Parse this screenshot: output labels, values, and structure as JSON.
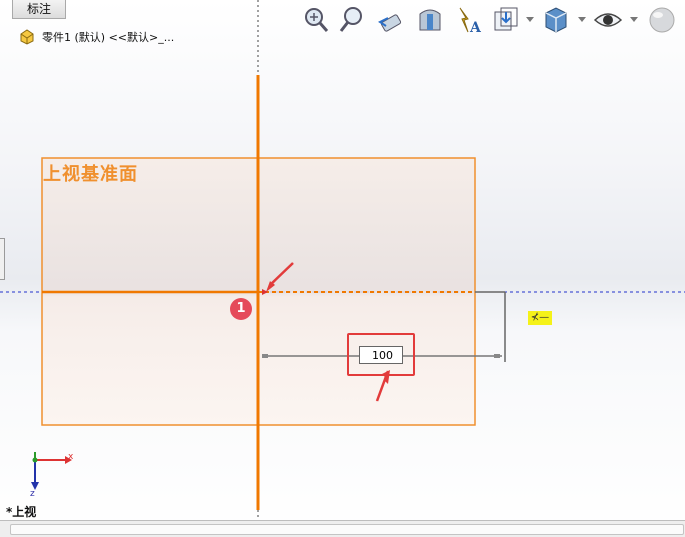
{
  "panel": {
    "tab_label": "标注",
    "tree_item_label": "零件1 (默认) <<默认>_..."
  },
  "toolbar": {
    "tools": [
      "zoom-to-fit-icon",
      "zoom-to-area-icon",
      "previous-view-icon",
      "section-view-icon",
      "dynamic-annotation-icon",
      "view-orientation-icon",
      "display-style-icon",
      "hide-show-items-icon",
      "appearance-icon"
    ]
  },
  "canvas": {
    "plane_label": "上视基准面",
    "marker_label": "1",
    "dimension_value": "100",
    "relation_symbol": "⊀—"
  },
  "status": {
    "view_label": "*上视"
  },
  "triad": {
    "x_label": "x",
    "z_label": "z"
  },
  "colors": {
    "plane_border": "#f0902e",
    "sketch_line": "#f07800",
    "highlight_red": "#e23b3b",
    "badge": "#e54a5a",
    "relation_tag": "#f5f219"
  }
}
